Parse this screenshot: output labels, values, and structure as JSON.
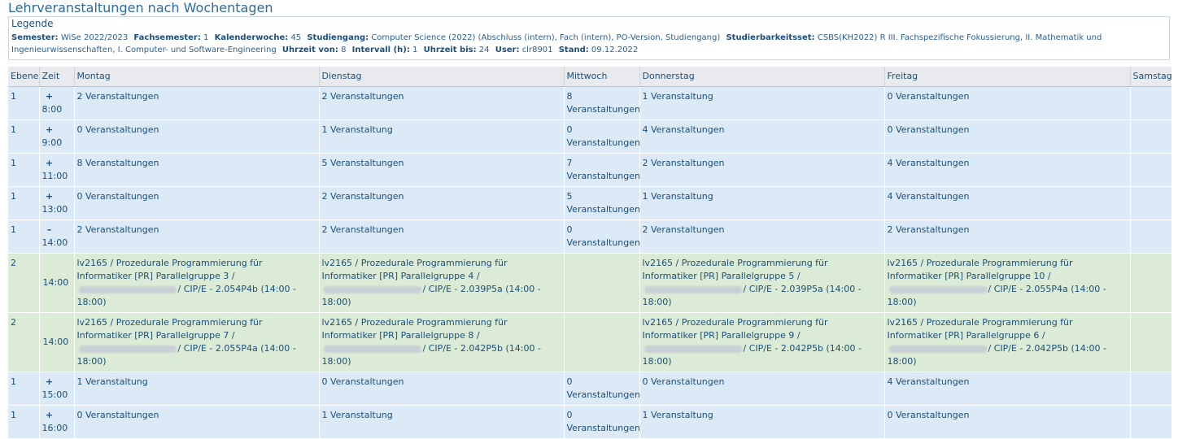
{
  "page": {
    "title": "Lehrveranstaltungen nach Wochentagen"
  },
  "legend": {
    "heading": "Legende",
    "items": [
      {
        "label": "Semester:",
        "value": "WiSe 2022/2023"
      },
      {
        "label": "Fachsemester:",
        "value": "1"
      },
      {
        "label": "Kalenderwoche:",
        "value": "45"
      },
      {
        "label": "Studiengang:",
        "value": "Computer Science (2022) (Abschluss (intern), Fach (intern), PO-Version, Studiengang)"
      },
      {
        "label": "Studierbarkeitsset:",
        "value": "CSBS(KH2022) R III. Fachspezifische Fokussierung, II. Mathematik und Ingenieurwissenschaften, I. Computer- und Software-Engineering"
      },
      {
        "label": "Uhrzeit von:",
        "value": "8"
      },
      {
        "label": "Intervall (h):",
        "value": "1"
      },
      {
        "label": "Uhrzeit bis:",
        "value": "24"
      },
      {
        "label": "User:",
        "value": "clr8901"
      },
      {
        "label": "Stand:",
        "value": "09.12.2022"
      }
    ]
  },
  "table": {
    "headers": [
      "Ebene",
      "Zeit",
      "Montag",
      "Dienstag",
      "Mittwoch",
      "Donnerstag",
      "Freitag",
      "Samstag"
    ],
    "rows": [
      {
        "level": "1",
        "toggle": "+",
        "time": "8:00",
        "cells": [
          "2 Veranstaltungen",
          "2 Veranstaltungen",
          "8 Veranstaltungen",
          "1 Veranstaltung",
          "0 Veranstaltungen",
          ""
        ]
      },
      {
        "level": "1",
        "toggle": "+",
        "time": "9:00",
        "cells": [
          "0 Veranstaltungen",
          "1 Veranstaltung",
          "0 Veranstaltungen",
          "4 Veranstaltungen",
          "0 Veranstaltungen",
          ""
        ]
      },
      {
        "level": "1",
        "toggle": "+",
        "time": "11:00",
        "cells": [
          "8 Veranstaltungen",
          "5 Veranstaltungen",
          "7 Veranstaltungen",
          "2 Veranstaltungen",
          "4 Veranstaltungen",
          ""
        ]
      },
      {
        "level": "1",
        "toggle": "+",
        "time": "13:00",
        "cells": [
          "0 Veranstaltungen",
          "2 Veranstaltungen",
          "5 Veranstaltungen",
          "1 Veranstaltung",
          "4 Veranstaltungen",
          ""
        ]
      },
      {
        "level": "1",
        "toggle": "–",
        "time": "14:00",
        "cells": [
          "2 Veranstaltungen",
          "2 Veranstaltungen",
          "0 Veranstaltungen",
          "2 Veranstaltungen",
          "2 Veranstaltungen",
          ""
        ]
      },
      {
        "level": "2",
        "time": "14:00",
        "events": [
          {
            "a": "lv2165 / Prozedurale Programmierung für Informatiker [PR] Parallelgruppe 3 /",
            "b": "/ CIP/E - 2.054P4b (14:00 - 18:00)"
          },
          {
            "a": "lv2165 / Prozedurale Programmierung für Informatiker [PR] Parallelgruppe 4 /",
            "b": "/ CIP/E - 2.039P5a (14:00 - 18:00)"
          },
          null,
          {
            "a": "lv2165 / Prozedurale Programmierung für Informatiker [PR] Parallelgruppe 5 /",
            "b": "/ CIP/E - 2.039P5a (14:00 - 18:00)"
          },
          {
            "a": "lv2165 / Prozedurale Programmierung für Informatiker [PR] Parallelgruppe 10 /",
            "b": "/ CIP/E - 2.055P4a (14:00 - 18:00)"
          },
          null
        ]
      },
      {
        "level": "2",
        "time": "14:00",
        "events": [
          {
            "a": "lv2165 / Prozedurale Programmierung für Informatiker [PR] Parallelgruppe 7 /",
            "b": "/ CIP/E - 2.055P4a (14:00 - 18:00)"
          },
          {
            "a": "lv2165 / Prozedurale Programmierung für Informatiker [PR] Parallelgruppe 8 /",
            "b": "/ CIP/E - 2.042P5b (14:00 - 18:00)"
          },
          null,
          {
            "a": "lv2165 / Prozedurale Programmierung für Informatiker [PR] Parallelgruppe 9 /",
            "b": "/ CIP/E - 2.042P5b (14:00 - 18:00)"
          },
          {
            "a": "lv2165 / Prozedurale Programmierung für Informatiker [PR] Parallelgruppe 6 /",
            "b": "/ CIP/E - 2.042P5b (14:00 - 18:00)"
          },
          null
        ]
      },
      {
        "level": "1",
        "toggle": "+",
        "time": "15:00",
        "cells": [
          "1 Veranstaltung",
          "0 Veranstaltungen",
          "0 Veranstaltungen",
          "0 Veranstaltungen",
          "4 Veranstaltungen",
          ""
        ]
      },
      {
        "level": "1",
        "toggle": "+",
        "time": "16:00",
        "cells": [
          "0 Veranstaltungen",
          "1 Veranstaltung",
          "0 Veranstaltungen",
          "1 Veranstaltung",
          "0 Veranstaltungen",
          ""
        ]
      }
    ]
  }
}
